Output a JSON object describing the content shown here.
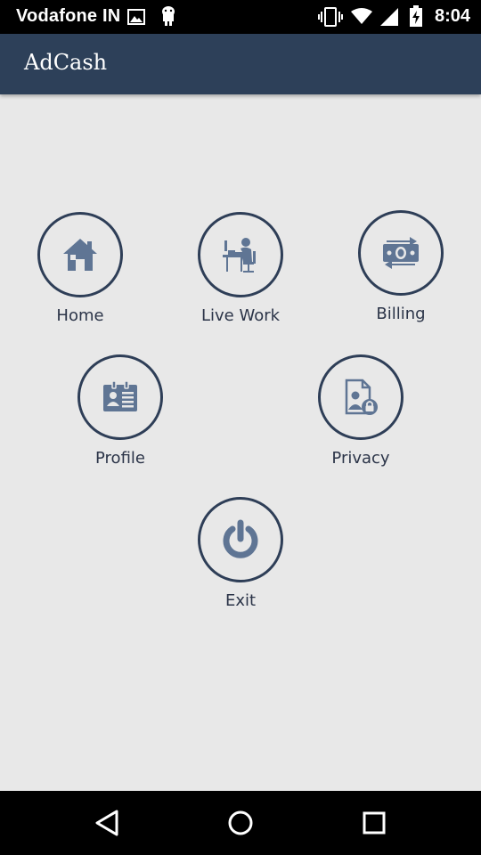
{
  "status_bar": {
    "carrier": "Vodafone IN",
    "time": "8:04",
    "icons": [
      "image-icon",
      "android-icon",
      "vibrate-icon",
      "wifi-icon",
      "signal-icon",
      "battery-charging-icon"
    ]
  },
  "app_bar": {
    "title": "AdCash"
  },
  "menu": {
    "home": {
      "label": "Home",
      "icon": "home-icon"
    },
    "live_work": {
      "label": "Live Work",
      "icon": "worker-at-desk-icon"
    },
    "billing": {
      "label": "Billing",
      "icon": "money-exchange-icon"
    },
    "profile": {
      "label": "Profile",
      "icon": "id-card-icon"
    },
    "privacy": {
      "label": "Privacy",
      "icon": "document-lock-icon"
    },
    "exit": {
      "label": "Exit",
      "icon": "power-icon"
    }
  },
  "nav_bar": {
    "icons": [
      "back-icon",
      "home-circle-icon",
      "recents-icon"
    ]
  },
  "colors": {
    "app_bar": "#2d4059",
    "background": "#e8e8e8",
    "circle_border": "#2e3e57",
    "icon_fill": "#5f7594",
    "label": "#2b3448"
  }
}
